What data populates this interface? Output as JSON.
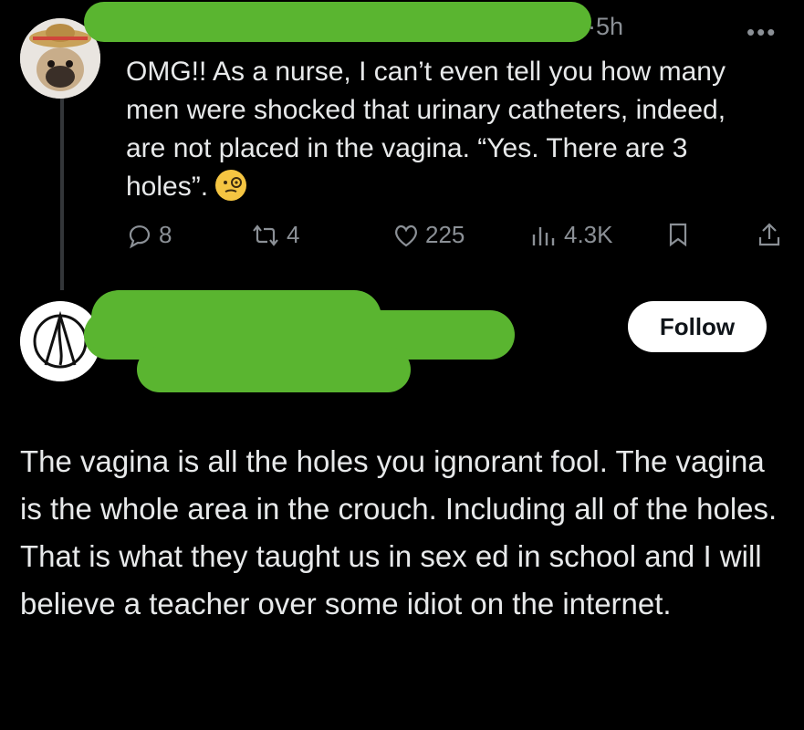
{
  "tweet": {
    "time": "5h",
    "more_label": "•••",
    "text": "OMG!! As a nurse, I can’t even tell you how many men were shocked that urinary catheters, indeed, are not placed in the vagina. “Yes. There are 3 holes”.",
    "emoji": "monocle-face",
    "dot": "·",
    "replies": "8",
    "reposts": "4",
    "likes": "225",
    "views": "4.3K"
  },
  "reply": {
    "follow_label": "Follow",
    "text": "The vagina is all the holes you ignorant fool. The vagina is the whole area in the crouch. Including all of the holes. That is what they taught us in sex ed in school and I will believe a teacher over some idiot on the internet."
  },
  "colors": {
    "background": "#000000",
    "text": "#e7e9ea",
    "muted": "#8b9096",
    "redaction": "#5ab530"
  }
}
